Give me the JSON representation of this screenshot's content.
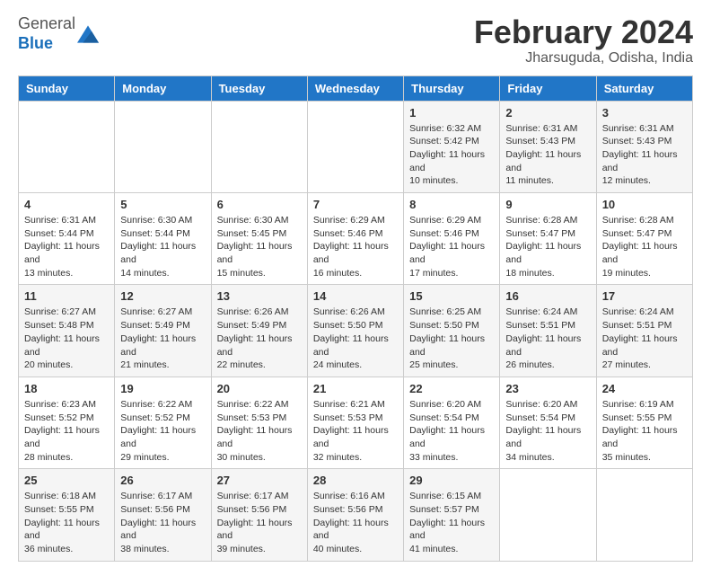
{
  "logo": {
    "general": "General",
    "blue": "Blue"
  },
  "header": {
    "month": "February 2024",
    "location": "Jharsuguda, Odisha, India"
  },
  "days": [
    "Sunday",
    "Monday",
    "Tuesday",
    "Wednesday",
    "Thursday",
    "Friday",
    "Saturday"
  ],
  "weeks": [
    [
      {
        "date": "",
        "text": ""
      },
      {
        "date": "",
        "text": ""
      },
      {
        "date": "",
        "text": ""
      },
      {
        "date": "",
        "text": ""
      },
      {
        "date": "1",
        "text": "Sunrise: 6:32 AM\nSunset: 5:42 PM\nDaylight: 11 hours and 10 minutes."
      },
      {
        "date": "2",
        "text": "Sunrise: 6:31 AM\nSunset: 5:43 PM\nDaylight: 11 hours and 11 minutes."
      },
      {
        "date": "3",
        "text": "Sunrise: 6:31 AM\nSunset: 5:43 PM\nDaylight: 11 hours and 12 minutes."
      }
    ],
    [
      {
        "date": "4",
        "text": "Sunrise: 6:31 AM\nSunset: 5:44 PM\nDaylight: 11 hours and 13 minutes."
      },
      {
        "date": "5",
        "text": "Sunrise: 6:30 AM\nSunset: 5:44 PM\nDaylight: 11 hours and 14 minutes."
      },
      {
        "date": "6",
        "text": "Sunrise: 6:30 AM\nSunset: 5:45 PM\nDaylight: 11 hours and 15 minutes."
      },
      {
        "date": "7",
        "text": "Sunrise: 6:29 AM\nSunset: 5:46 PM\nDaylight: 11 hours and 16 minutes."
      },
      {
        "date": "8",
        "text": "Sunrise: 6:29 AM\nSunset: 5:46 PM\nDaylight: 11 hours and 17 minutes."
      },
      {
        "date": "9",
        "text": "Sunrise: 6:28 AM\nSunset: 5:47 PM\nDaylight: 11 hours and 18 minutes."
      },
      {
        "date": "10",
        "text": "Sunrise: 6:28 AM\nSunset: 5:47 PM\nDaylight: 11 hours and 19 minutes."
      }
    ],
    [
      {
        "date": "11",
        "text": "Sunrise: 6:27 AM\nSunset: 5:48 PM\nDaylight: 11 hours and 20 minutes."
      },
      {
        "date": "12",
        "text": "Sunrise: 6:27 AM\nSunset: 5:49 PM\nDaylight: 11 hours and 21 minutes."
      },
      {
        "date": "13",
        "text": "Sunrise: 6:26 AM\nSunset: 5:49 PM\nDaylight: 11 hours and 22 minutes."
      },
      {
        "date": "14",
        "text": "Sunrise: 6:26 AM\nSunset: 5:50 PM\nDaylight: 11 hours and 24 minutes."
      },
      {
        "date": "15",
        "text": "Sunrise: 6:25 AM\nSunset: 5:50 PM\nDaylight: 11 hours and 25 minutes."
      },
      {
        "date": "16",
        "text": "Sunrise: 6:24 AM\nSunset: 5:51 PM\nDaylight: 11 hours and 26 minutes."
      },
      {
        "date": "17",
        "text": "Sunrise: 6:24 AM\nSunset: 5:51 PM\nDaylight: 11 hours and 27 minutes."
      }
    ],
    [
      {
        "date": "18",
        "text": "Sunrise: 6:23 AM\nSunset: 5:52 PM\nDaylight: 11 hours and 28 minutes."
      },
      {
        "date": "19",
        "text": "Sunrise: 6:22 AM\nSunset: 5:52 PM\nDaylight: 11 hours and 29 minutes."
      },
      {
        "date": "20",
        "text": "Sunrise: 6:22 AM\nSunset: 5:53 PM\nDaylight: 11 hours and 30 minutes."
      },
      {
        "date": "21",
        "text": "Sunrise: 6:21 AM\nSunset: 5:53 PM\nDaylight: 11 hours and 32 minutes."
      },
      {
        "date": "22",
        "text": "Sunrise: 6:20 AM\nSunset: 5:54 PM\nDaylight: 11 hours and 33 minutes."
      },
      {
        "date": "23",
        "text": "Sunrise: 6:20 AM\nSunset: 5:54 PM\nDaylight: 11 hours and 34 minutes."
      },
      {
        "date": "24",
        "text": "Sunrise: 6:19 AM\nSunset: 5:55 PM\nDaylight: 11 hours and 35 minutes."
      }
    ],
    [
      {
        "date": "25",
        "text": "Sunrise: 6:18 AM\nSunset: 5:55 PM\nDaylight: 11 hours and 36 minutes."
      },
      {
        "date": "26",
        "text": "Sunrise: 6:17 AM\nSunset: 5:56 PM\nDaylight: 11 hours and 38 minutes."
      },
      {
        "date": "27",
        "text": "Sunrise: 6:17 AM\nSunset: 5:56 PM\nDaylight: 11 hours and 39 minutes."
      },
      {
        "date": "28",
        "text": "Sunrise: 6:16 AM\nSunset: 5:56 PM\nDaylight: 11 hours and 40 minutes."
      },
      {
        "date": "29",
        "text": "Sunrise: 6:15 AM\nSunset: 5:57 PM\nDaylight: 11 hours and 41 minutes."
      },
      {
        "date": "",
        "text": ""
      },
      {
        "date": "",
        "text": ""
      }
    ]
  ]
}
